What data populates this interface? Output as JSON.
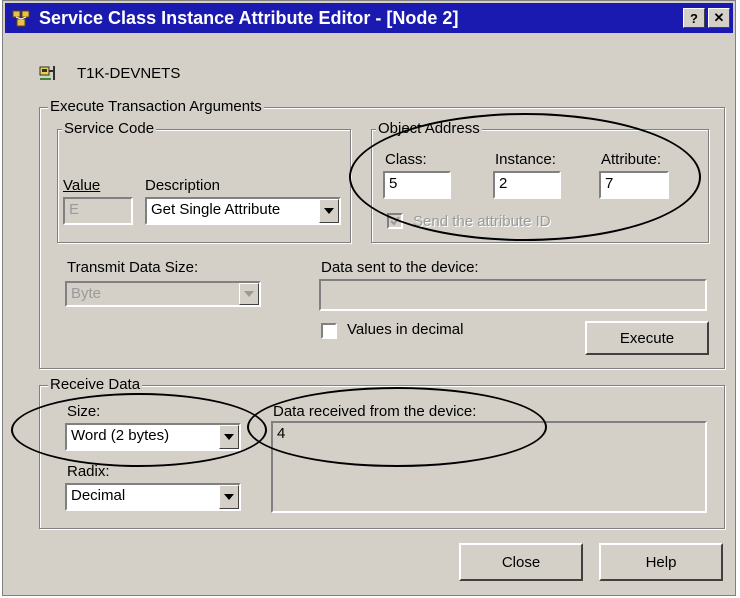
{
  "window": {
    "title": "Service Class Instance Attribute Editor - [Node 2]",
    "help_glyph": "?",
    "close_glyph": "✕"
  },
  "device": {
    "name": "T1K-DEVNETS",
    "icon": "device-icon"
  },
  "execute_group": {
    "legend": "Execute Transaction Arguments",
    "service_code": {
      "legend": "Service Code",
      "value_label": "Value",
      "value": "E",
      "description_label": "Description",
      "description_value": "Get Single Attribute"
    },
    "object_address": {
      "legend": "Object Address",
      "class_label": "Class:",
      "class_value": "5",
      "instance_label": "Instance:",
      "instance_value": "2",
      "attribute_label": "Attribute:",
      "attribute_value": "7",
      "send_attr_label": "Send the attribute ID",
      "send_attr_checked": true
    },
    "transmit_size_label": "Transmit Data Size:",
    "transmit_size_value": "Byte",
    "data_sent_label": "Data sent to the device:",
    "data_sent_value": "",
    "values_decimal_label": "Values in decimal",
    "values_decimal_checked": false,
    "execute_label": "Execute"
  },
  "receive_group": {
    "legend": "Receive Data",
    "size_label": "Size:",
    "size_value": "Word (2 bytes)",
    "radix_label": "Radix:",
    "radix_value": "Decimal",
    "data_received_label": "Data received from the device:",
    "data_received_value": "4"
  },
  "buttons": {
    "close": "Close",
    "help": "Help"
  }
}
